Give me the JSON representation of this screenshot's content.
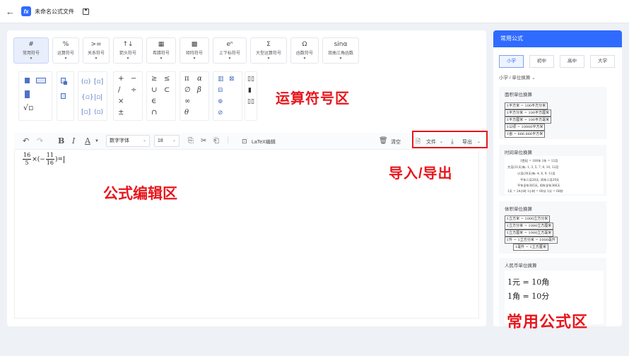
{
  "titlebar": {
    "file_name": "未命名公式文件",
    "logo_text": "fx"
  },
  "categories": [
    {
      "icon": "#",
      "label": "常用符号"
    },
    {
      "icon": "%",
      "label": "运算符号"
    },
    {
      "icon": ">=",
      "label": "关系符号"
    },
    {
      "icon": "↑↓",
      "label": "箭头符号"
    },
    {
      "icon": "▦",
      "label": "希腊符号"
    },
    {
      "icon": "▩",
      "label": "矩阵符号"
    },
    {
      "icon": "eⁿ",
      "label": "上下标符号"
    },
    {
      "icon": "Σ",
      "label": "大型运算符号"
    },
    {
      "icon": "Ω",
      "label": "函数符号"
    },
    {
      "icon": "sinα",
      "label": "双曲三角函数"
    }
  ],
  "operators": {
    "row1": [
      "+",
      "−"
    ],
    "row2": [
      "/",
      "÷"
    ],
    "row3": [
      "×"
    ],
    "row4": [
      "±"
    ],
    "rel1": [
      "≥",
      "≤"
    ],
    "rel2": [
      "∪",
      "⊂"
    ],
    "rel3": [
      "∈"
    ],
    "rel4": [
      "∩"
    ],
    "greek1": [
      "π",
      "α"
    ],
    "greek2": [
      "∅",
      "β"
    ],
    "greek3": [
      "∞"
    ],
    "greek4": [
      "θ"
    ]
  },
  "toolbar": {
    "bold": "B",
    "italic": "I",
    "color": "A",
    "font": "数字字体",
    "size": "18",
    "latex": "LaTeX编辑",
    "clear": "清空",
    "file": "文件",
    "export": "导出"
  },
  "formula": {
    "frac1_num": "16",
    "frac1_den": "5",
    "times": "×(−",
    "frac2_num": "11",
    "frac2_den": "16",
    "tail": ")="
  },
  "right": {
    "title": "常用公式",
    "tabs": [
      "小学",
      "初中",
      "高中",
      "大学"
    ],
    "sub": "小学 / 单位换算",
    "area_title": "面积单位换算",
    "area_rows": [
      "1平方米 = 100平方分米",
      "1平方分米 = 100平方厘米",
      "1平方厘米 = 100平方毫米",
      "1公顷 = 10000平方米",
      "1亩 = 666.666平方米"
    ],
    "time_title": "时间单位换算",
    "time_rows": [
      "1世纪 = 100年   1年 = 12月",
      "大月(31天)有: 1, 3, 5, 7, 8, 10, 12月",
      "小月(30天)有: 4, 6, 9, 11月",
      "平年二月28天, 闰年二月29天",
      "平年全年365天, 闰年全年366天",
      "1天 = 24小时  1小时 = 60分  1分 = 60秒"
    ],
    "vol_title": "体积单位换算",
    "vol_rows": [
      "1立方米 = 1000立方分米",
      "1立方分米 = 1000立方厘米",
      "1立方厘米 = 1000立方毫米",
      "1升 = 1立方分米 = 1000毫升",
      "1毫升 = 1立方厘米"
    ],
    "rmb_title": "人民币单位换算",
    "rmb_rows": [
      "1元 = 10角",
      "1角 = 10分"
    ]
  },
  "annotations": {
    "operator_area": "运算符号区",
    "editor_area": "公式编辑区",
    "import_export": "导入/导出",
    "common_area": "常用公式区"
  },
  "colors": {
    "accent": "#2f6bff",
    "annotation": "#e8161c"
  }
}
